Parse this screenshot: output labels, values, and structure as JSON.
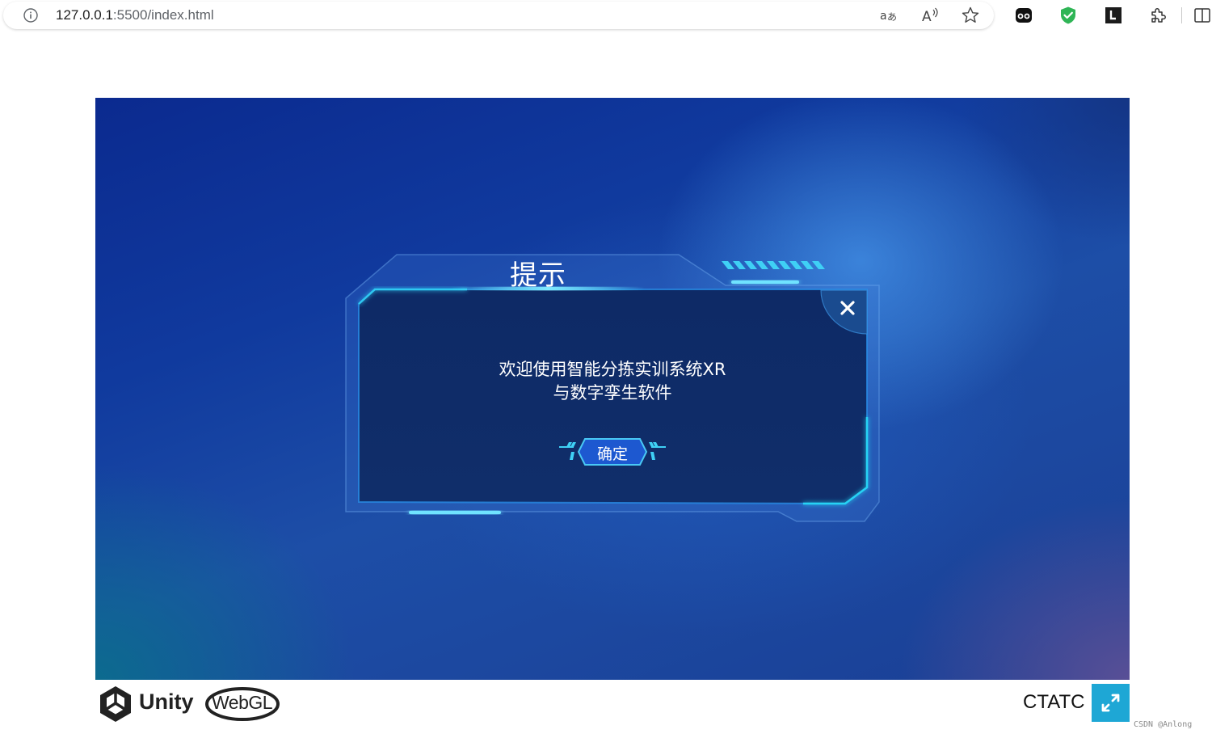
{
  "browser": {
    "url_host": "127.0.0.1",
    "url_path": ":5500/index.html",
    "icons": [
      "info-icon",
      "translate-icon",
      "read-aloud-icon",
      "favorite-star-icon",
      "extension-panda-icon",
      "extension-shield-icon",
      "extension-l-icon",
      "extensions-puzzle-icon",
      "split-screen-icon"
    ]
  },
  "dialog": {
    "title": "提示",
    "message_line1": "欢迎使用智能分拣实训系统XR",
    "message_line2": "与数字孪生软件",
    "confirm_label": "确定",
    "close_icon": "close-icon"
  },
  "footer": {
    "unity_label": "Unity",
    "webgl_label": "WebGL",
    "app_title": "CTATC",
    "fullscreen_icon": "fullscreen-expand-icon"
  },
  "watermark": "CSDN @Anlong",
  "colors": {
    "accent_cyan": "#1ea7d5",
    "dialog_bg": "#0f2a63",
    "frame_glow": "#27d3f5"
  }
}
